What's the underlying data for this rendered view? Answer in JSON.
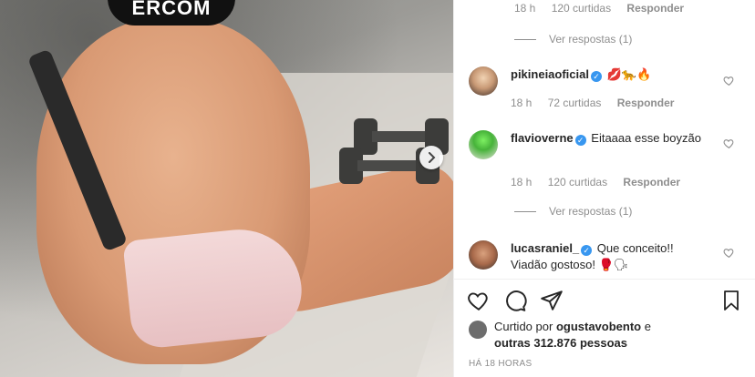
{
  "photo": {
    "cap_text": "ERCOM",
    "alt": ""
  },
  "comments_panel": {
    "top_meta": {
      "time": "18 h",
      "likes": "120 curtidas",
      "reply": "Responder"
    },
    "top_view_replies": "Ver respostas (1)",
    "comments": [
      {
        "username": "pikineiaoficial",
        "verified": true,
        "text": "💋🐆🔥",
        "time": "18 h",
        "likes": "72 curtidas",
        "reply": "Responder"
      },
      {
        "username": "flavioverne",
        "verified": true,
        "text": "Eitaaaa esse boyzão",
        "time": "18 h",
        "likes": "120 curtidas",
        "reply": "Responder",
        "view_replies": "Ver respostas (1)"
      },
      {
        "username": "lucasraniel_",
        "verified": true,
        "text": "Que conceito!! Viadão gostoso! 🥊🗣",
        "time": "",
        "likes": "",
        "reply": ""
      }
    ]
  },
  "likes_summary": {
    "prefix": "Curtido por",
    "user": "ogustavobento",
    "middle": "e",
    "others": "outras 312.876 pessoas"
  },
  "timestamp": "HÁ 18 HORAS",
  "colors": {
    "verified": "#3897f0",
    "text": "#262626",
    "muted": "#8e8e8e"
  },
  "icons": [
    "heart-icon",
    "comment-icon",
    "share-icon",
    "bookmark-icon",
    "chevron-right-icon"
  ]
}
